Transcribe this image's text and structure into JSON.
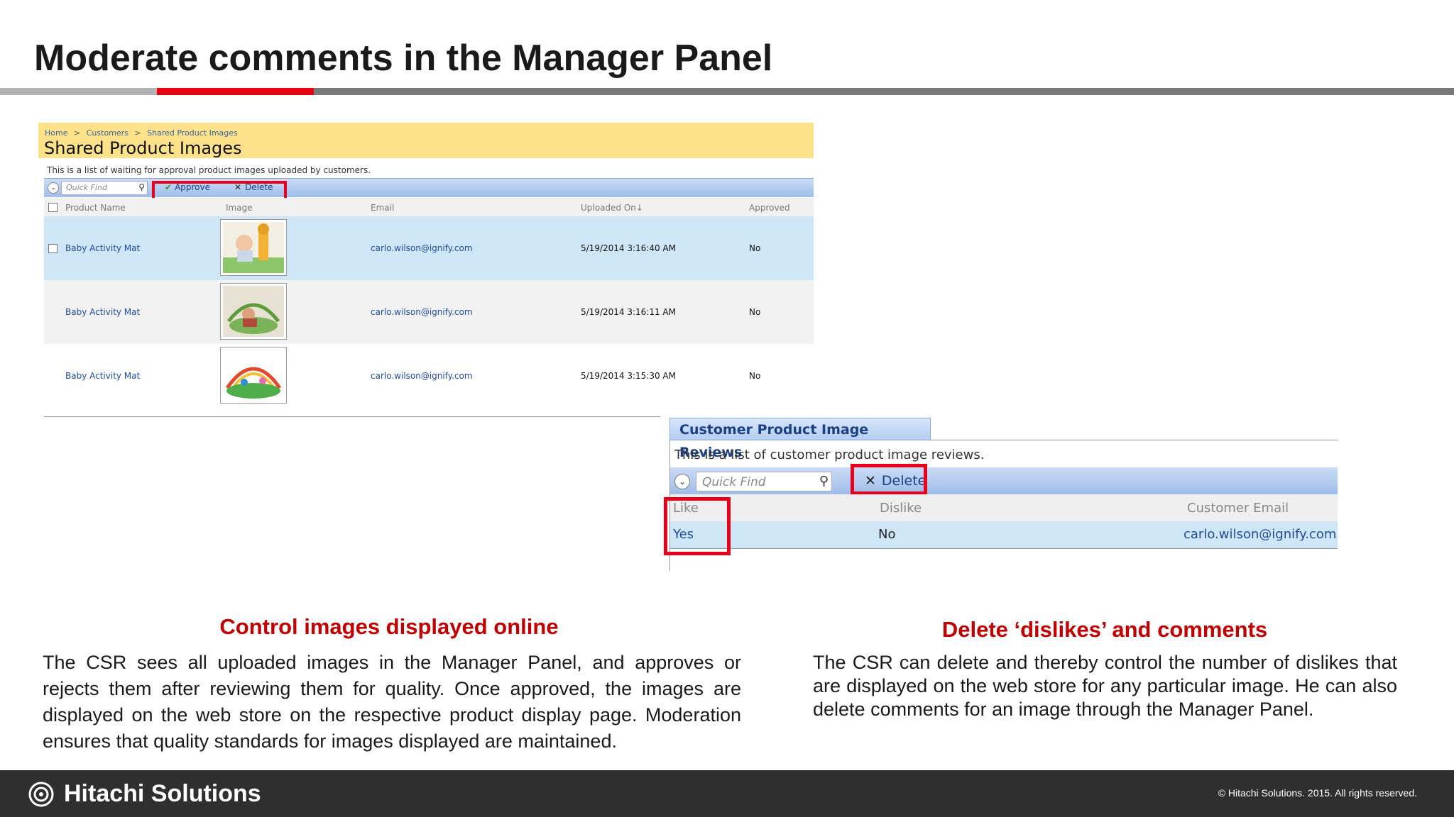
{
  "slide": {
    "title": "Moderate comments in the Manager Panel"
  },
  "shared_images_panel": {
    "breadcrumb": [
      "Home",
      ">",
      "Customers",
      ">",
      "Shared Product Images"
    ],
    "title": "Shared Product Images",
    "description": "This is a list of waiting for approval product images uploaded by customers.",
    "quick_find_placeholder": "Quick Find",
    "approve_label": "Approve",
    "delete_label": "Delete",
    "columns": [
      "Product Name",
      "Image",
      "Email",
      "Uploaded On↓",
      "Approved"
    ],
    "rows": [
      {
        "product_name": "Baby Activity Mat",
        "email": "carlo.wilson@ignify.com",
        "uploaded_on": "5/19/2014 3:16:40 AM",
        "approved": "No"
      },
      {
        "product_name": "Baby Activity Mat",
        "email": "carlo.wilson@ignify.com",
        "uploaded_on": "5/19/2014 3:16:11 AM",
        "approved": "No"
      },
      {
        "product_name": "Baby Activity Mat",
        "email": "carlo.wilson@ignify.com",
        "uploaded_on": "5/19/2014 3:15:30 AM",
        "approved": "No"
      }
    ]
  },
  "reviews_panel": {
    "tab_label": "Customer Product Image Reviews",
    "description": "This is a list of customer product image reviews.",
    "quick_find_placeholder": "Quick Find",
    "delete_label": "Delete",
    "columns": [
      "Like",
      "Dislike",
      "Customer Email"
    ],
    "rows": [
      {
        "like": "Yes",
        "dislike": "No",
        "customer_email": "carlo.wilson@ignify.com"
      }
    ]
  },
  "captions": {
    "left": {
      "heading": "Control images displayed online",
      "body": "The CSR sees all uploaded images in the Manager Panel, and approves or rejects them after reviewing them for quality. Once approved, the images are displayed on the web store on the respective product display page. Moderation ensures that quality standards for images displayed are maintained."
    },
    "right": {
      "heading": "Delete ‘dislikes’ and comments",
      "body": "The CSR can delete and thereby control the number of dislikes that are displayed on the web store for any particular image. He can also delete comments for an image through the Manager Panel."
    }
  },
  "footer": {
    "logo_text": "Hitachi Solutions",
    "copyright": "©  Hitachi Solutions. 2015. All rights reserved."
  },
  "colors": {
    "accent_red": "#e60012",
    "caption_red": "#c00000",
    "footer_bg": "#2f2f2f",
    "crm_header_yellow": "#fde28a",
    "crm_link_blue": "#1f4b99"
  }
}
